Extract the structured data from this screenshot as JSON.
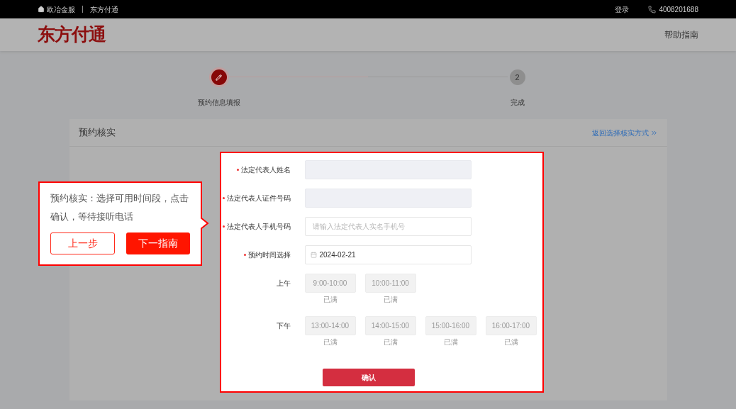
{
  "top_bar": {
    "home_link": "欧冶金服",
    "site": "东方付通",
    "login": "登录",
    "phone": "4008201688"
  },
  "header": {
    "logo": "东方付通",
    "help": "帮助指南"
  },
  "steps": [
    {
      "label": "预约信息填报",
      "active": true
    },
    {
      "label": "完成",
      "number": "2",
      "active": false
    }
  ],
  "card": {
    "title": "预约核实",
    "back_link": "返回选择核实方式"
  },
  "form": {
    "fields": [
      {
        "label": "法定代表人姓名",
        "required": true,
        "kind": "text",
        "disabled": true
      },
      {
        "label": "法定代表人证件号码",
        "required": true,
        "kind": "text",
        "disabled": true
      },
      {
        "label": "法定代表人手机号码",
        "required": true,
        "kind": "text",
        "disabled": false,
        "placeholder": "请输入法定代表人实名手机号"
      },
      {
        "label": "预约时间选择",
        "required": true,
        "kind": "date",
        "disabled": false,
        "value": "2024-02-21"
      }
    ],
    "time_groups": [
      {
        "label": "上午",
        "slots": [
          {
            "time": "9:00-10:00",
            "status": "已满",
            "disabled": true
          },
          {
            "time": "10:00-11:00",
            "status": "已满",
            "disabled": true
          }
        ]
      },
      {
        "label": "下午",
        "slots": [
          {
            "time": "13:00-14:00",
            "status": "已满",
            "disabled": true
          },
          {
            "time": "14:00-15:00",
            "status": "已满",
            "disabled": true
          },
          {
            "time": "15:00-16:00",
            "status": "已满",
            "disabled": true
          },
          {
            "time": "16:00-17:00",
            "status": "已满",
            "disabled": true
          }
        ]
      }
    ],
    "submit": "确认"
  },
  "tour": {
    "text": "预约核实：选择可用时间段，点击确认，等待接听电话",
    "prev": "上一步",
    "next": "下一指南"
  }
}
